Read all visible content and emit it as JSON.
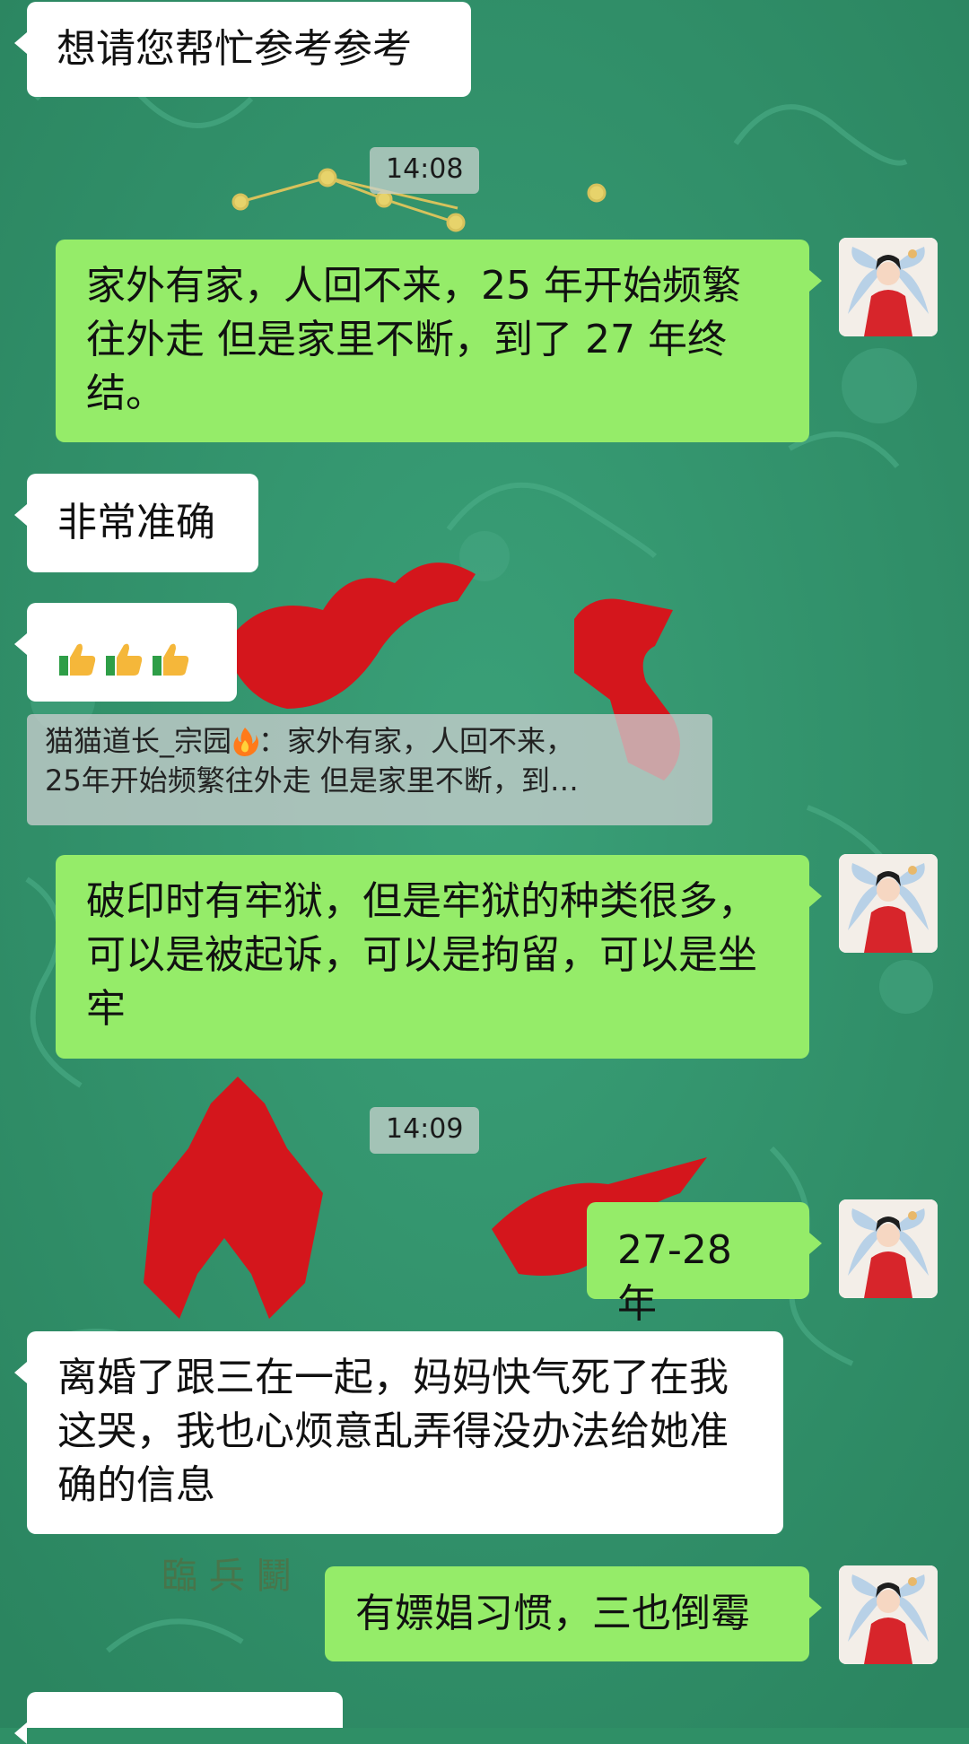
{
  "messages": [
    {
      "side": "left",
      "text": "想请您帮忙参考参考"
    },
    {
      "time": "14:08"
    },
    {
      "side": "right",
      "text": "家外有家，人回不来，25 年开始频繁往外走 但是家里不断，到了 27 年终结。"
    },
    {
      "side": "left",
      "text": "非常准确"
    },
    {
      "side": "left",
      "emoji": [
        "thumbs-up",
        "thumbs-up",
        "thumbs-up"
      ]
    },
    {
      "quote": {
        "sender": "猫猫道长_宗园",
        "line1": "：家外有家，人回不来，",
        "line2": "25年开始频繁往外走 但是家里不断，到…"
      }
    },
    {
      "side": "right",
      "text": "破印时有牢狱，但是牢狱的种类很多，可以是被起诉，可以是拘留，可以是坐牢"
    },
    {
      "time": "14:09"
    },
    {
      "side": "right",
      "text": "27-28 年"
    },
    {
      "side": "left",
      "text": "离婚了跟三在一起，妈妈快气死了在我这哭，我也心烦意乱弄得没办法给她准确的信息"
    },
    {
      "side": "right",
      "text": "有嫖娼习惯，三也倒霉"
    }
  ],
  "background": {
    "base_color": "#2f8f66",
    "seal_color": "#d4161c",
    "faint_text": "臨 兵 鬭"
  },
  "colors": {
    "bubble_left": "#ffffff",
    "bubble_right": "#95ec69"
  }
}
